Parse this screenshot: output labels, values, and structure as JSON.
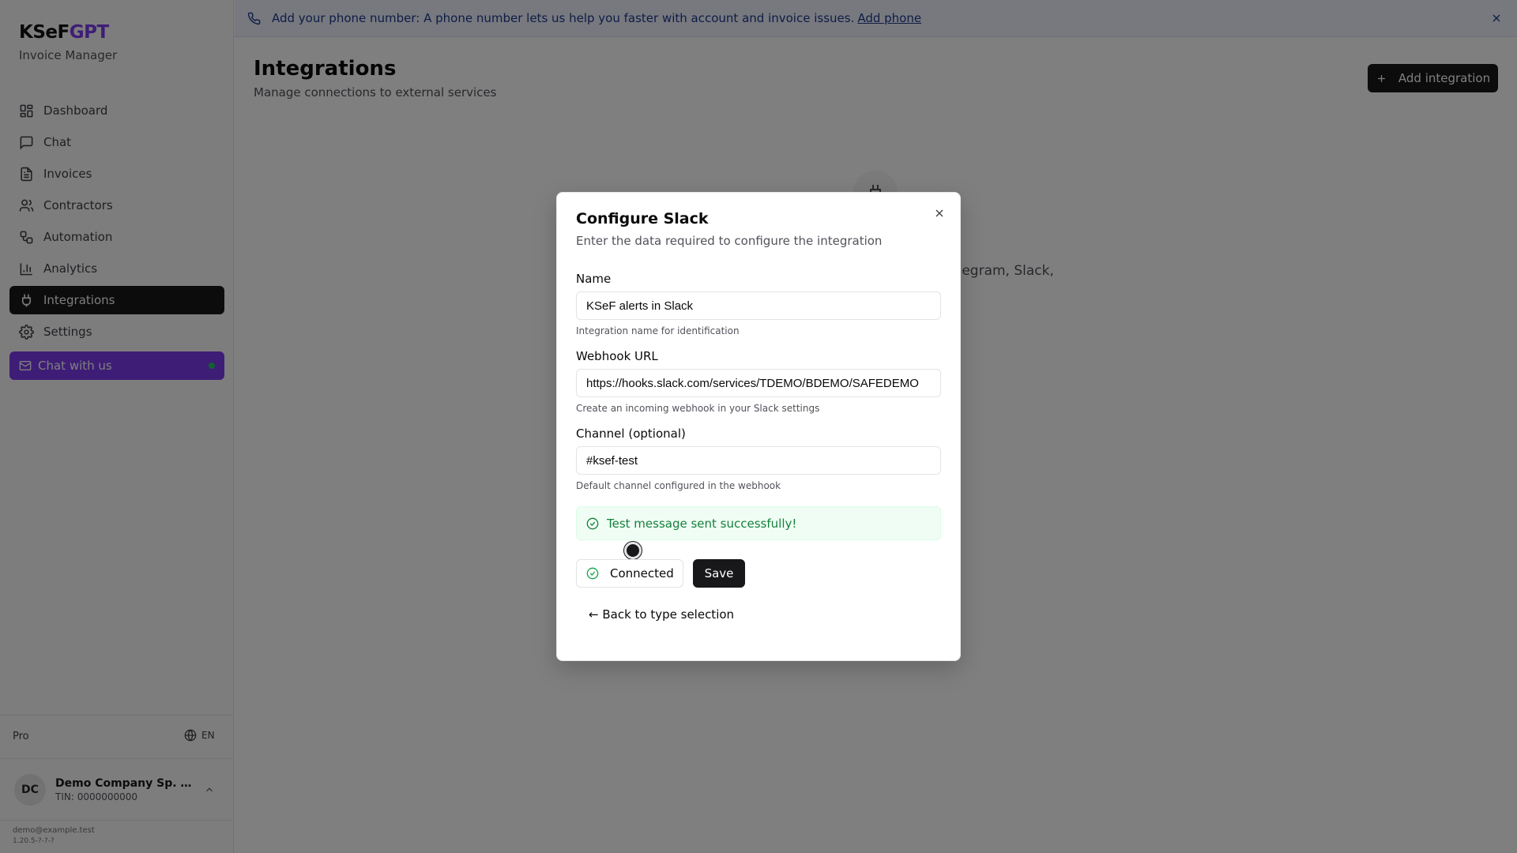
{
  "brand": {
    "name_main": "KSeF",
    "name_accent": "GPT",
    "subtitle": "Invoice Manager"
  },
  "nav": [
    {
      "label": "Dashboard",
      "icon": "dashboard-icon"
    },
    {
      "label": "Chat",
      "icon": "chat-icon"
    },
    {
      "label": "Invoices",
      "icon": "invoice-icon"
    },
    {
      "label": "Contractors",
      "icon": "users-icon"
    },
    {
      "label": "Automation",
      "icon": "workflow-icon"
    },
    {
      "label": "Analytics",
      "icon": "chart-icon"
    },
    {
      "label": "Integrations",
      "icon": "plug-icon",
      "active": true
    },
    {
      "label": "Settings",
      "icon": "gear-icon"
    }
  ],
  "chat_us": {
    "label": "Chat with us",
    "status_color": "#22c55e"
  },
  "sidebar_footer": {
    "plan": "Pro",
    "language": "EN",
    "company_initials": "DC",
    "company_name": "Demo Company Sp. z o.o.",
    "company_tin": "TIN: 0000000000",
    "email": "demo@example.test",
    "version": "1.20.5-?-?-?"
  },
  "banner": {
    "text": "Add your phone number: A phone number lets us help you faster with account and invoice issues.",
    "link": "Add phone"
  },
  "page": {
    "title": "Integrations",
    "subtitle": "Manage connections to external services",
    "add_button": "Add integration",
    "empty_text": "No integrations configured yet. Add Telegram, Slack, Email"
  },
  "modal": {
    "title": "Configure Slack",
    "description": "Enter the data required to configure the integration",
    "name_label": "Name",
    "name_value": "KSeF alerts in Slack",
    "name_hint": "Integration name for identification",
    "webhook_label": "Webhook URL",
    "webhook_value": "https://hooks.slack.com/services/TDEMO/BDEMO/SAFEDEMO",
    "webhook_hint": "Create an incoming webhook in your Slack settings",
    "channel_label": "Channel (optional)",
    "channel_value": "#ksef-test",
    "channel_hint": "Default channel configured in the webhook",
    "alert": "Test message sent successfully!",
    "connected_label": "Connected",
    "save_label": "Save",
    "back_label": "← Back to type selection"
  },
  "colors": {
    "accent": "#7c3aed",
    "success": "#15803d",
    "dark": "#18181b"
  }
}
